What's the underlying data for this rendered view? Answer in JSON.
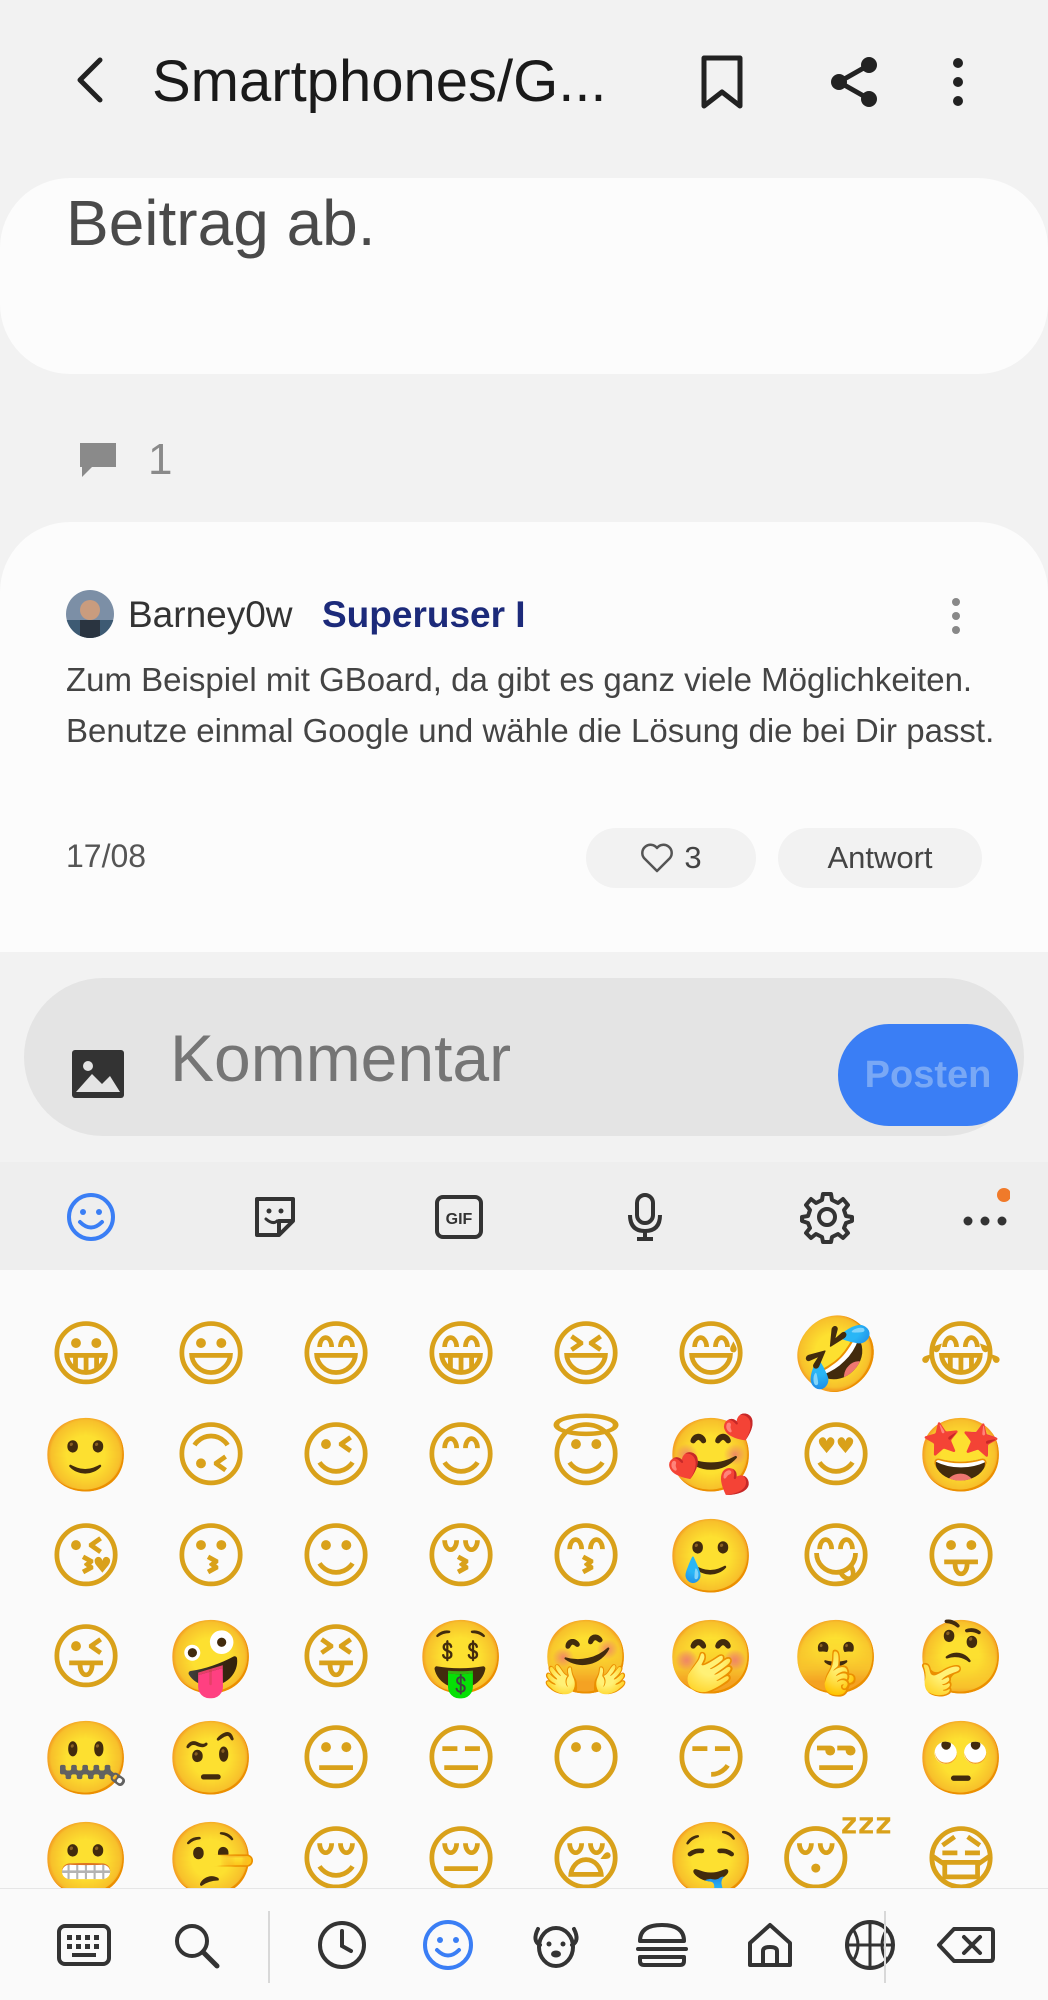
{
  "header": {
    "title": "Smartphones/G...",
    "back_icon": "chevron-left-icon",
    "bookmark_icon": "bookmark-icon",
    "share_icon": "share-icon",
    "more_icon": "more-vertical-icon"
  },
  "post": {
    "text": "Beitrag ab."
  },
  "comments": {
    "count": "1",
    "icon": "comment-icon"
  },
  "reply": {
    "author": "Barney0w",
    "rank": "Superuser I",
    "body": "Zum Beispiel mit GBoard, da gibt es ganz viele Möglichkeiten. Benutze einmal Google und wähle die Lösung die bei Dir passt.",
    "date": "17/08",
    "likes": "3",
    "answer_label": "Antwort"
  },
  "composer": {
    "placeholder": "Kommentar",
    "post_label": "Posten",
    "image_icon": "image-icon"
  },
  "keyboard_toolbar": {
    "items": [
      "emoji-icon",
      "sticker-icon",
      "gif-icon",
      "microphone-icon",
      "gear-icon",
      "more-horizontal-icon"
    ],
    "gif_label": "GIF",
    "notification_color": "#f07a2a"
  },
  "emoji_rows": [
    [
      "😀",
      "😃",
      "😄",
      "😁",
      "😆",
      "😅",
      "🤣",
      "😂"
    ],
    [
      "🙂",
      "🙃",
      "😉",
      "😊",
      "😇",
      "🥰",
      "😍",
      "🤩"
    ],
    [
      "😘",
      "😗",
      "☺",
      "😚",
      "😙",
      "🥲",
      "😋",
      "😛"
    ],
    [
      "😜",
      "🤪",
      "😝",
      "🤑",
      "🤗",
      "🤭",
      "🤫",
      "🤔"
    ],
    [
      "🤐",
      "🤨",
      "😐",
      "😑",
      "😶",
      "😏",
      "😒",
      "🙄"
    ],
    [
      "😬",
      "🤥",
      "😌",
      "😔",
      "😪",
      "🤤",
      "😴",
      "😷"
    ]
  ],
  "keyboard_nav": {
    "items": [
      "keyboard-icon",
      "search-icon",
      "recent-clock-icon",
      "smiley-icon",
      "animal-icon",
      "food-icon",
      "house-icon",
      "sports-ball-icon",
      "backspace-icon"
    ],
    "active": "smiley-icon",
    "accent_color": "#3a7ef5"
  }
}
